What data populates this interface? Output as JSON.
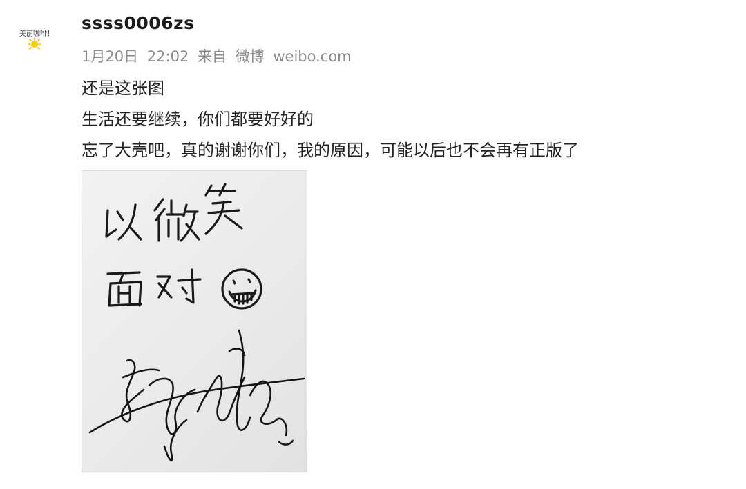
{
  "author": {
    "avatar_caption": "美丽咖啡！",
    "username": "ssss0006zs"
  },
  "meta": {
    "date": "1月20日",
    "time": "22:02",
    "source_prefix": "来自",
    "source_name": "微博",
    "source_domain": "weibo.com"
  },
  "post": {
    "lines": [
      "还是这张图",
      "生活还要继续，你们都要好好的",
      "忘了大壳吧，真的谢谢你们，我的原因，可能以后也不会再有正版了"
    ]
  },
  "photo": {
    "handwriting": [
      "以微笑",
      "面对"
    ]
  }
}
